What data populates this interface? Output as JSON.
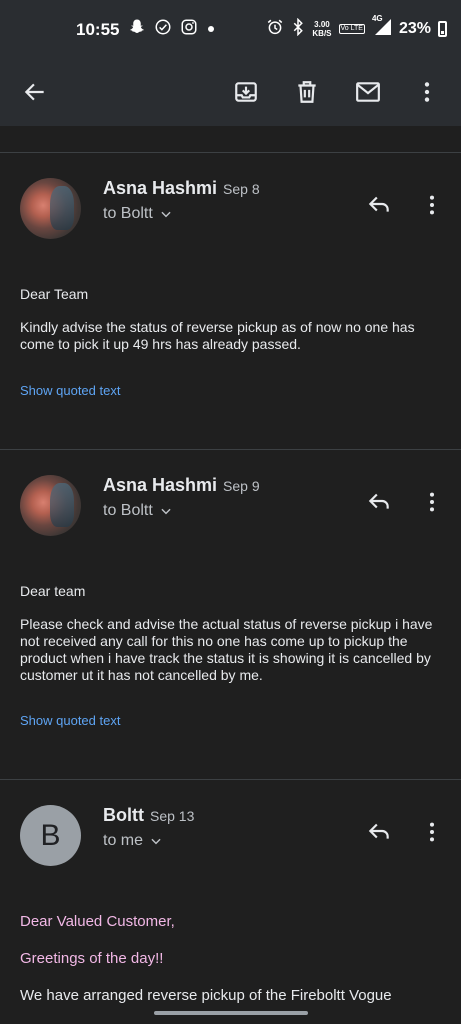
{
  "status_bar": {
    "time": "10:55",
    "speed_value": "3.00",
    "speed_unit": "KB/S",
    "volte": "Vo LTE",
    "network": "4G",
    "battery": "23%"
  },
  "messages": [
    {
      "sender": "Asna Hashmi",
      "date": "Sep 8",
      "to": "to Boltt",
      "greeting": "Dear Team",
      "body": "Kindly advise the status of reverse pickup as of now no one has come to pick it up 49 hrs has already passed.",
      "quoted_link": "Show quoted text"
    },
    {
      "sender": "Asna Hashmi",
      "date": "Sep 9",
      "to": "to Boltt",
      "greeting": "Dear team",
      "body": "Please check and advise the actual status of reverse pickup i have not received any call for this no one has come up to pickup the product when i have track the status it is showing it is cancelled by customer ut it has not cancelled by me.",
      "quoted_link": "Show quoted text"
    },
    {
      "sender": "Boltt",
      "avatar_letter": "B",
      "date": "Sep 13",
      "to": "to me",
      "line1": "Dear Valued Customer,",
      "line2": "Greetings of the day!!",
      "line3": "We have arranged reverse pickup of the Fireboltt Vogue"
    }
  ],
  "colors": {
    "background": "#1f1f1f",
    "toolbar": "#2a2d31",
    "link": "#5ea4f3",
    "highlight_text": "#f2b8e6"
  },
  "icons": [
    "back-arrow-icon",
    "archive-icon",
    "delete-icon",
    "mark-unread-icon",
    "more-vert-icon",
    "reply-icon",
    "chevron-down-icon"
  ]
}
